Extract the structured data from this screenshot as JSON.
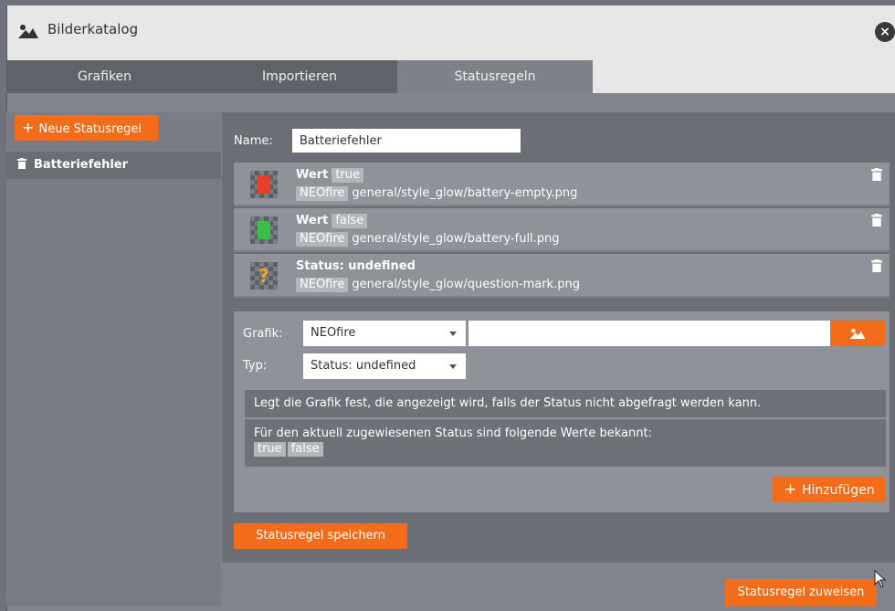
{
  "window": {
    "title": "Bilderkatalog",
    "close_label": "×"
  },
  "tabs": [
    {
      "label": "Grafiken"
    },
    {
      "label": "Importieren"
    },
    {
      "label": "Statusregeln"
    }
  ],
  "sidebar": {
    "new_rule_label": "Neue Statusregel",
    "items": [
      {
        "label": "Batteriefehler"
      }
    ]
  },
  "editor": {
    "name_label": "Name:",
    "name_value": "Batteriefehler",
    "rules": [
      {
        "title": "Wert",
        "value": "true",
        "source": "NEOfire",
        "path": "general/style_glow/battery-empty.png",
        "color": "#e8402a"
      },
      {
        "title": "Wert",
        "value": "false",
        "source": "NEOfire",
        "path": "general/style_glow/battery-full.png",
        "color": "#3bbf4a"
      },
      {
        "title": "Status: undefined",
        "value": "",
        "source": "NEOfire",
        "path": "general/style_glow/question-mark.png",
        "color": "#f5a623"
      }
    ],
    "form": {
      "grafik_label": "Grafik:",
      "grafik_value": "NEOfire",
      "typ_label": "Typ:",
      "typ_value": "Status: undefined",
      "info_text": "Legt die Grafik fest, die angezeigt wird, falls der Status nicht abgefragt werden kann.",
      "known_values_text": "Für den aktuell zugewiesenen Status sind folgende Werte bekannt:",
      "known_values": [
        "true",
        "false"
      ],
      "add_label": "Hinzufügen"
    },
    "save_label": "Statusregel speichern"
  },
  "footer": {
    "assign_label": "Statusregel zuweisen"
  },
  "colors": {
    "accent": "#f26c1a"
  }
}
